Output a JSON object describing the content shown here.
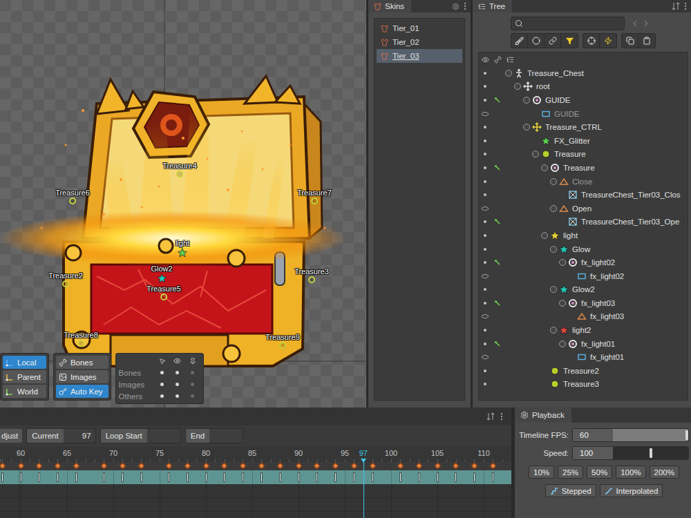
{
  "viewport": {
    "bones": [
      {
        "label": "Treasure4",
        "kind": "bone",
        "color": "#c8d23c"
      },
      {
        "label": "Treasure6",
        "kind": "bone",
        "color": "#c8d23c"
      },
      {
        "label": "Treasure7",
        "kind": "bone",
        "color": "#c8d23c"
      },
      {
        "label": "light",
        "kind": "star",
        "color": "#5ccf4e"
      },
      {
        "label": "Glow2",
        "kind": "star",
        "color": "#22c9b6"
      },
      {
        "label": "Treasure5",
        "kind": "bone",
        "color": "#c8d23c"
      },
      {
        "label": "Treasure2",
        "kind": "bone",
        "color": "#c8d23c"
      },
      {
        "label": "Treasure3",
        "kind": "bone",
        "color": "#c8d23c"
      },
      {
        "label": "Treasure8",
        "kind": "bone",
        "color": "#c8d23c"
      },
      {
        "label": "Treasure9",
        "kind": "bone",
        "color": "#c8d23c"
      }
    ],
    "axis_modes": [
      {
        "label": "Local",
        "selected": true
      },
      {
        "label": "Parent",
        "selected": false
      },
      {
        "label": "World",
        "selected": false
      }
    ],
    "toggles": [
      {
        "label": "Bones",
        "kind": "bones",
        "selected": false
      },
      {
        "label": "Images",
        "kind": "images",
        "selected": false
      },
      {
        "label": "Auto Key",
        "kind": "autokey",
        "selected": true
      }
    ],
    "visibility": [
      {
        "label": "Bones",
        "states": [
          true,
          true,
          false
        ]
      },
      {
        "label": "Images",
        "states": [
          true,
          true,
          false
        ]
      },
      {
        "label": "Others",
        "states": [
          true,
          true,
          false
        ]
      }
    ]
  },
  "skins": {
    "title": "Skins",
    "items": [
      {
        "label": "Tier_01",
        "selected": false
      },
      {
        "label": "Tier_02",
        "selected": false
      },
      {
        "label": "Tier_03",
        "selected": true
      }
    ]
  },
  "tree": {
    "title": "Tree",
    "filters": [
      {
        "selected": false
      },
      {
        "selected": false
      },
      {
        "selected": false
      },
      {
        "selected": true
      }
    ],
    "rows": [
      {
        "label": "Treasure_Chest",
        "depth": 0,
        "kind": "skeleton",
        "expanded": true,
        "visible": true,
        "keyed": false,
        "dim": false
      },
      {
        "label": "root",
        "depth": 1,
        "kind": "bone-cross",
        "color": "#e6e6e6",
        "expanded": true,
        "visible": true,
        "keyed": false,
        "dim": false
      },
      {
        "label": "GUIDE",
        "depth": 2,
        "kind": "slot",
        "expanded": true,
        "visible": true,
        "keyed": true,
        "dim": false
      },
      {
        "label": "GUIDE",
        "depth": 3,
        "kind": "region",
        "expanded": false,
        "visible": false,
        "keyed": false,
        "dim": true
      },
      {
        "label": "Treasure_CTRL",
        "depth": 2,
        "kind": "bone-cross",
        "color": "#e8d23a",
        "expanded": true,
        "visible": true,
        "keyed": false,
        "dim": false
      },
      {
        "label": "FX_Glitter",
        "depth": 3,
        "kind": "star",
        "color": "#5ccf4e",
        "expanded": false,
        "visible": true,
        "keyed": false,
        "dim": false
      },
      {
        "label": "Treasure",
        "depth": 3,
        "kind": "bone",
        "color": "#b8cf2a",
        "expanded": true,
        "visible": true,
        "keyed": false,
        "dim": false
      },
      {
        "label": "Treasure",
        "depth": 4,
        "kind": "slot",
        "expanded": true,
        "visible": true,
        "keyed": true,
        "dim": false
      },
      {
        "label": "Close",
        "depth": 5,
        "kind": "placeholder",
        "expanded": true,
        "visible": true,
        "keyed": false,
        "dim": true
      },
      {
        "label": "TreasureChest_Tier03_Clos",
        "depth": 6,
        "kind": "mesh",
        "expanded": false,
        "visible": true,
        "keyed": false,
        "dim": false
      },
      {
        "label": "Open",
        "depth": 5,
        "kind": "placeholder",
        "expanded": true,
        "visible": false,
        "keyed": false,
        "dim": false
      },
      {
        "label": "TreasureChest_Tier03_Ope",
        "depth": 6,
        "kind": "mesh",
        "expanded": false,
        "visible": true,
        "keyed": true,
        "dim": false
      },
      {
        "label": "light",
        "depth": 4,
        "kind": "star",
        "color": "#e8d23a",
        "expanded": true,
        "visible": true,
        "keyed": false,
        "dim": false
      },
      {
        "label": "Glow",
        "depth": 5,
        "kind": "star",
        "color": "#22c9b6",
        "expanded": true,
        "visible": true,
        "keyed": false,
        "dim": false
      },
      {
        "label": "fx_light02",
        "depth": 6,
        "kind": "slot",
        "expanded": true,
        "visible": true,
        "keyed": true,
        "dim": false
      },
      {
        "label": "fx_light02",
        "depth": 7,
        "kind": "region",
        "expanded": false,
        "visible": false,
        "keyed": false,
        "dim": false
      },
      {
        "label": "Glow2",
        "depth": 5,
        "kind": "star",
        "color": "#22c9b6",
        "expanded": true,
        "visible": true,
        "keyed": false,
        "dim": false
      },
      {
        "label": "fx_light03",
        "depth": 6,
        "kind": "slot",
        "expanded": true,
        "visible": true,
        "keyed": true,
        "dim": false
      },
      {
        "label": "fx_light03",
        "depth": 7,
        "kind": "placeholder",
        "expanded": false,
        "visible": false,
        "keyed": false,
        "dim": false
      },
      {
        "label": "light2",
        "depth": 5,
        "kind": "star",
        "color": "#e0453a",
        "expanded": true,
        "visible": true,
        "keyed": false,
        "dim": false
      },
      {
        "label": "fx_light01",
        "depth": 6,
        "kind": "slot",
        "expanded": true,
        "visible": true,
        "keyed": true,
        "dim": false
      },
      {
        "label": "fx_light01",
        "depth": 7,
        "kind": "region",
        "expanded": false,
        "visible": false,
        "keyed": false,
        "dim": false
      },
      {
        "label": "Treasure2",
        "depth": 4,
        "kind": "bone",
        "color": "#b8cf2a",
        "expanded": false,
        "visible": true,
        "keyed": false,
        "dim": false
      },
      {
        "label": "Treasure3",
        "depth": 4,
        "kind": "bone",
        "color": "#b8cf2a",
        "expanded": false,
        "visible": true,
        "keyed": false,
        "dim": false
      }
    ]
  },
  "timeline": {
    "adjust": "djust",
    "current_label": "Current",
    "current": "97",
    "loop_start_label": "Loop Start",
    "loop_start": "",
    "end_label": "End",
    "end": "",
    "ruler": [
      "60",
      "65",
      "70",
      "75",
      "80",
      "85",
      "90",
      "95",
      "100",
      "105",
      "110"
    ],
    "playhead": "97",
    "keys": [
      58,
      60,
      62,
      64,
      66,
      69,
      71,
      73,
      76,
      78,
      80,
      82,
      84,
      86,
      88,
      90,
      92,
      94,
      96,
      98,
      101,
      103,
      105,
      107,
      109,
      111
    ]
  },
  "playback": {
    "title": "Playback",
    "fps_label": "Timeline FPS:",
    "fps": "60",
    "fps_level": 1.0,
    "speed_label": "Speed:",
    "speed": "100",
    "speed_level": 0.5,
    "presets": [
      {
        "label": "10%"
      },
      {
        "label": "25%"
      },
      {
        "label": "50%"
      },
      {
        "label": "100%"
      },
      {
        "label": "200%"
      }
    ],
    "modes": [
      {
        "label": "Stepped",
        "kind": "stepped"
      },
      {
        "label": "Interpolated",
        "kind": "interpolated"
      }
    ]
  }
}
